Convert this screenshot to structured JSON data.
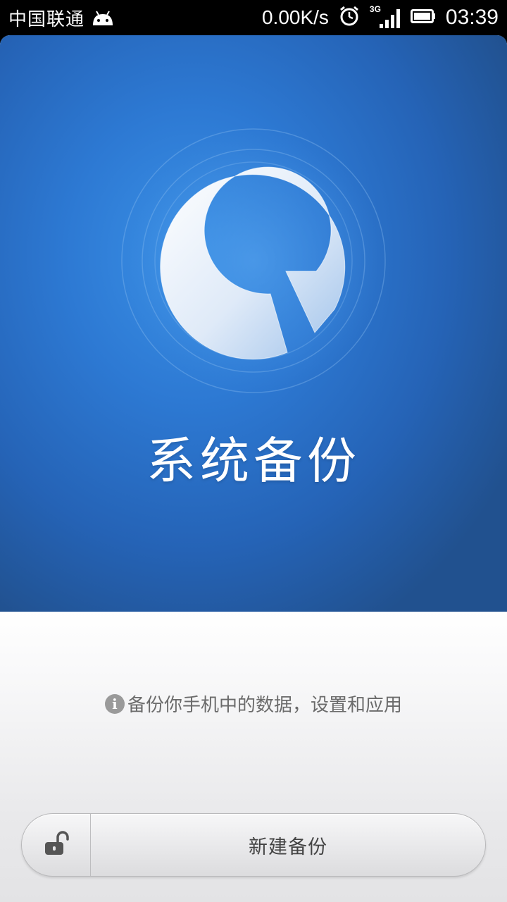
{
  "status_bar": {
    "carrier": "中国联通",
    "net_speed": "0.00K/s",
    "network_type": "3G",
    "time": "03:39",
    "icons": [
      "android-icon",
      "alarm-icon",
      "signal-icon",
      "battery-icon"
    ]
  },
  "hero": {
    "title": "系统备份",
    "logo_icon": "backup-logo-icon",
    "colors": {
      "top": "#3a90e6",
      "bottom": "#21518f"
    }
  },
  "description": {
    "icon": "info-icon",
    "text": "备份你手机中的数据，设置和应用"
  },
  "actions": {
    "lock_icon": "unlock-icon",
    "create_label": "新建备份"
  }
}
